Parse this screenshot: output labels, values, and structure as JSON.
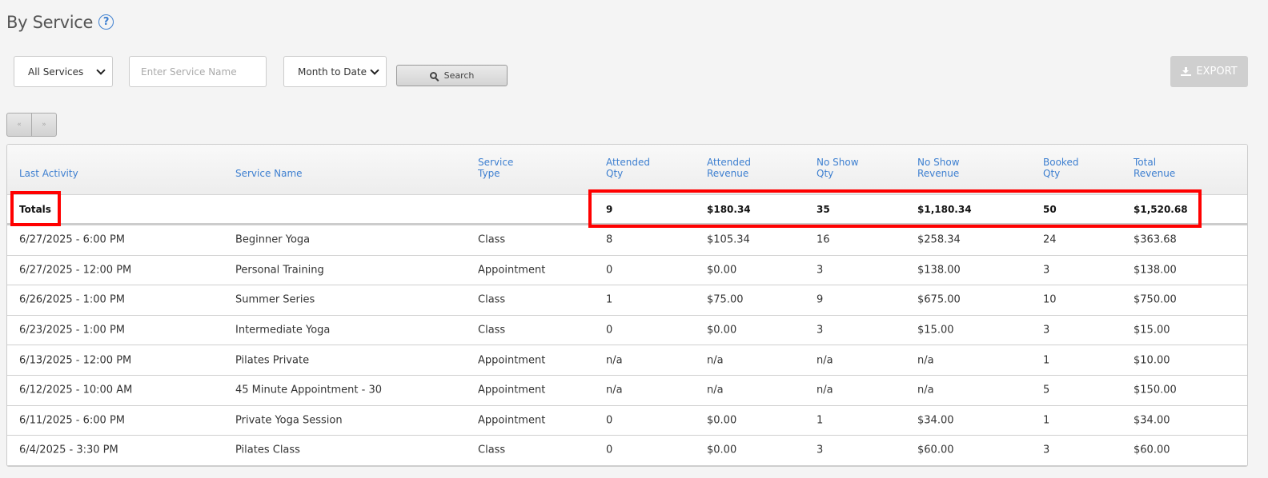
{
  "page": {
    "title": "By Service",
    "help_icon": "?"
  },
  "filters": {
    "service_select": "All Services",
    "service_name_placeholder": "Enter Service Name",
    "date_range_select": "Month to Date",
    "search_label": "Search"
  },
  "export_label": "EXPORT",
  "pager": {
    "prev": "«",
    "next": "»"
  },
  "table": {
    "headers": [
      [
        "Last Activity",
        ""
      ],
      [
        "Service Name",
        ""
      ],
      [
        "Service",
        "Type"
      ],
      [
        "Attended",
        "Qty"
      ],
      [
        "Attended",
        "Revenue"
      ],
      [
        "No Show",
        "Qty"
      ],
      [
        "No Show",
        "Revenue"
      ],
      [
        "Booked",
        "Qty"
      ],
      [
        "Total",
        "Revenue"
      ]
    ],
    "totals": [
      "Totals",
      "",
      "",
      "9",
      "$180.34",
      "35",
      "$1,180.34",
      "50",
      "$1,520.68"
    ],
    "rows": [
      [
        "6/27/2025 - 6:00 PM",
        "Beginner Yoga",
        "Class",
        "8",
        "$105.34",
        "16",
        "$258.34",
        "24",
        "$363.68"
      ],
      [
        "6/27/2025 - 12:00 PM",
        "Personal Training",
        "Appointment",
        "0",
        "$0.00",
        "3",
        "$138.00",
        "3",
        "$138.00"
      ],
      [
        "6/26/2025 - 1:00 PM",
        "Summer Series",
        "Class",
        "1",
        "$75.00",
        "9",
        "$675.00",
        "10",
        "$750.00"
      ],
      [
        "6/23/2025 - 1:00 PM",
        "Intermediate Yoga",
        "Class",
        "0",
        "$0.00",
        "3",
        "$15.00",
        "3",
        "$15.00"
      ],
      [
        "6/13/2025 - 12:00 PM",
        "Pilates Private",
        "Appointment",
        "n/a",
        "n/a",
        "n/a",
        "n/a",
        "1",
        "$10.00"
      ],
      [
        "6/12/2025 - 10:00 AM",
        "45 Minute Appointment - 30",
        "Appointment",
        "n/a",
        "n/a",
        "n/a",
        "n/a",
        "5",
        "$150.00"
      ],
      [
        "6/11/2025 - 6:00 PM",
        "Private Yoga Session",
        "Appointment",
        "0",
        "$0.00",
        "1",
        "$34.00",
        "1",
        "$34.00"
      ],
      [
        "6/4/2025 - 3:30 PM",
        "Pilates Class",
        "Class",
        "0",
        "$0.00",
        "3",
        "$60.00",
        "3",
        "$60.00"
      ]
    ]
  },
  "colors": {
    "link": "#3d7fd0",
    "highlight": "#ff0000",
    "export_disabled": "#cfcfcf"
  }
}
